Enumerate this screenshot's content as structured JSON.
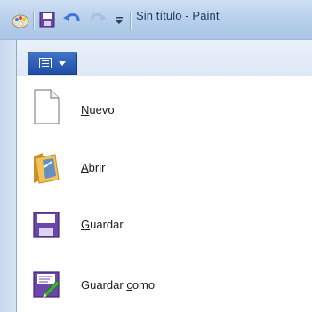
{
  "window": {
    "title": "Sin título - Paint"
  },
  "quick_access": {
    "icons": [
      "paint-app-icon",
      "save-icon",
      "undo-icon",
      "redo-icon",
      "customize-icon"
    ]
  },
  "ribbon": {
    "paint_button_icon": "paint-menu-icon"
  },
  "menu": {
    "items": [
      {
        "pre": "",
        "mnemonic": "N",
        "post": "uevo",
        "icon": "new-file-icon"
      },
      {
        "pre": "",
        "mnemonic": "A",
        "post": "brir",
        "icon": "open-folder-icon"
      },
      {
        "pre": "",
        "mnemonic": "G",
        "post": "uardar",
        "icon": "save-icon"
      },
      {
        "pre": "Guardar ",
        "mnemonic": "c",
        "post": "omo",
        "icon": "save-as-icon"
      }
    ]
  },
  "colors": {
    "titlebar": "#b9d1ec",
    "paint_button": "#2a5cb4",
    "title_text": "#1e395b"
  }
}
